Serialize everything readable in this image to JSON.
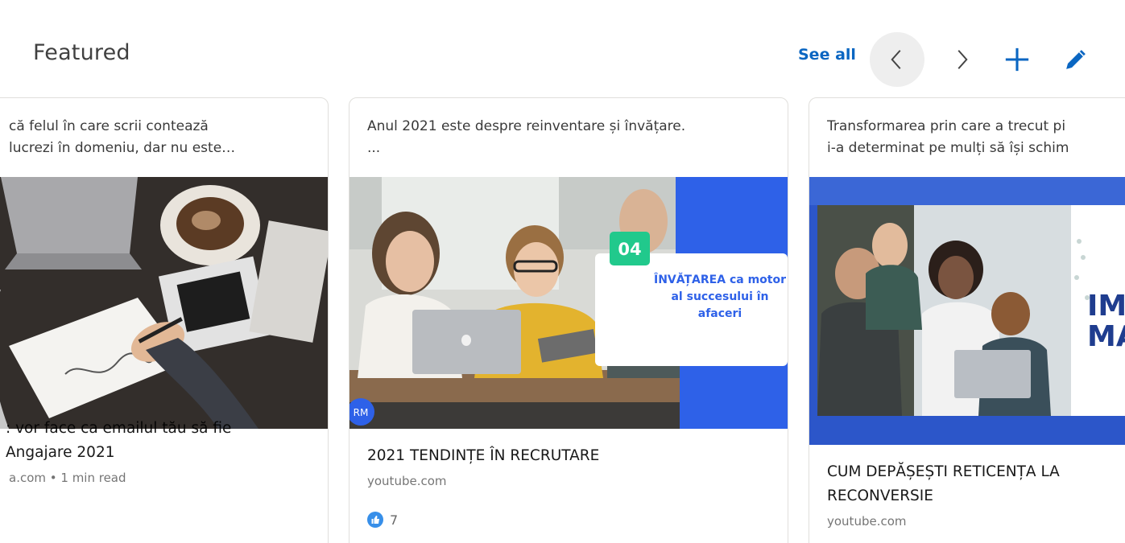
{
  "header": {
    "title": "Featured",
    "see_all": "See all",
    "prev_icon": "chevron-left-icon",
    "next_icon": "chevron-right-icon",
    "add_icon": "plus-icon",
    "edit_icon": "pencil-icon"
  },
  "colors": {
    "accent": "#0a66c2",
    "like": "#378fe9",
    "thumb2_blue": "#2e61e8",
    "thumb2_green": "#21c98c"
  },
  "cards": [
    {
      "desc_line1": "că felul în care scrii contează",
      "desc_line2": "lucrezi în domeniu, dar nu este…",
      "title_line1": ": vor face ca emailul tău să fie",
      "title_line2": "Angajare 2021",
      "source": "a.com • 1 min read"
    },
    {
      "desc_line1": "Anul 2021 este despre reinventare și învățare.",
      "desc_line2": "...",
      "thumb_number": "04",
      "thumb_text_line1": "ÎNVĂȚAREA ca motor",
      "thumb_text_line2": "al succesului în",
      "thumb_text_line3": "afaceri",
      "thumb_logo": "RM",
      "title": "2021 TENDINȚE ÎN RECRUTARE",
      "source": "youtube.com",
      "reaction_icon": "thumbs-up-icon",
      "reaction_count": "7"
    },
    {
      "desc_line1": "Transformarea prin care a trecut pi",
      "desc_line2": "i-a determinat pe mulți să își schim",
      "thumb_text_line1": "IMI",
      "thumb_text_line2": "MA",
      "title_line1": "CUM DEPĂȘEȘTI RETICENȚA LA",
      "title_line2": "RECONVERSIE",
      "source": "youtube.com"
    }
  ]
}
